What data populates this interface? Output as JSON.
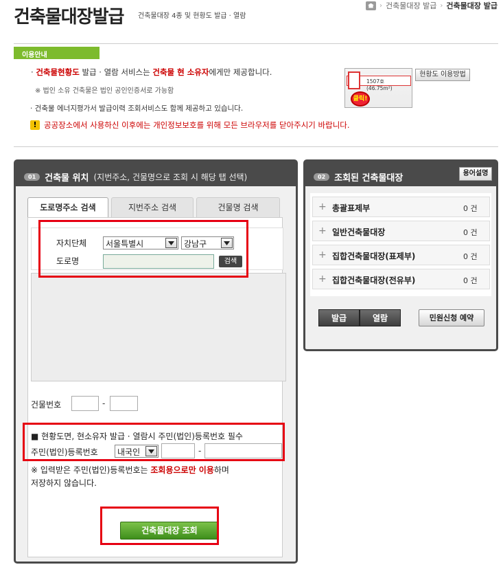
{
  "header": {
    "title": "건축물대장발급",
    "subtitle": "건축물대장 4종 및 현황도 발급 · 열람",
    "breadcrumb": [
      "건축물대장 발급",
      "건축물대장 발급"
    ]
  },
  "guide": {
    "tab_label": "이용안내",
    "line1_a": "· ",
    "line1_b": "건축물현황도",
    "line1_c": " 발급 · 열람 서비스는 ",
    "line1_d": "건축물 현 소유자",
    "line1_e": "에게만 제공합니다.",
    "note": "※ 법인 소유 건축물은 법인 공인인증서로 가능함",
    "line2": "· 건축물 에너지평가서 발급이력 조회서비스도 함께 제공하고 있습니다.",
    "warning": "공공장소에서 사용하신 이후에는 개인정보보호를 위해 모든 브라우저를 닫아주시기 바랍니다.",
    "howto_button": "현황도 이용방법",
    "thumb_text": "1507호 (46.75m²)",
    "thumb_click": "클릭!"
  },
  "left_panel": {
    "number": "01",
    "title": "건축물 위치",
    "subtitle": "(지번주소, 건물명으로 조회 시 해당 탭 선택)",
    "tabs": [
      {
        "label": "도로명주소 검색",
        "active": true
      },
      {
        "label": "지번주소 검색",
        "active": false
      },
      {
        "label": "건물명 검색",
        "active": false
      }
    ],
    "region_label": "자치단체",
    "sido_value": "서울특별시",
    "sigungu_value": "강남구",
    "road_label": "도로명",
    "road_value": "",
    "search_button": "검색",
    "building_no_label": "건물번호",
    "dash": "-",
    "required_title": "■ 현황도면, 현소유자 발급 · 열람시 주민(법인)등록번호 필수",
    "reg_label": "주민(법인)등록번호",
    "reg_type_value": "내국인",
    "notice_a": "※ 입력받은 주민(법인)등록번호는 ",
    "notice_b": "조회용으로만 이용",
    "notice_c": "하며",
    "notice2": "저장하지 않습니다.",
    "submit_button": "건축물대장 조회"
  },
  "right_panel": {
    "number": "02",
    "title": "조회된 건축물대장",
    "help_button": "용어설명",
    "items": [
      {
        "label": "총괄표제부",
        "count": "0 건"
      },
      {
        "label": "일반건축물대장",
        "count": "0 건"
      },
      {
        "label": "집합건축물대장(표제부)",
        "count": "0 건"
      },
      {
        "label": "집합건축물대장(전유부)",
        "count": "0 건"
      }
    ],
    "issue_button": "발급",
    "view_button": "열람",
    "reserve_button": "민원신청 예약"
  },
  "colors": {
    "accent_green": "#7dbb2d",
    "highlight_red": "#e60012",
    "panel_dark": "#4a4a4a"
  }
}
